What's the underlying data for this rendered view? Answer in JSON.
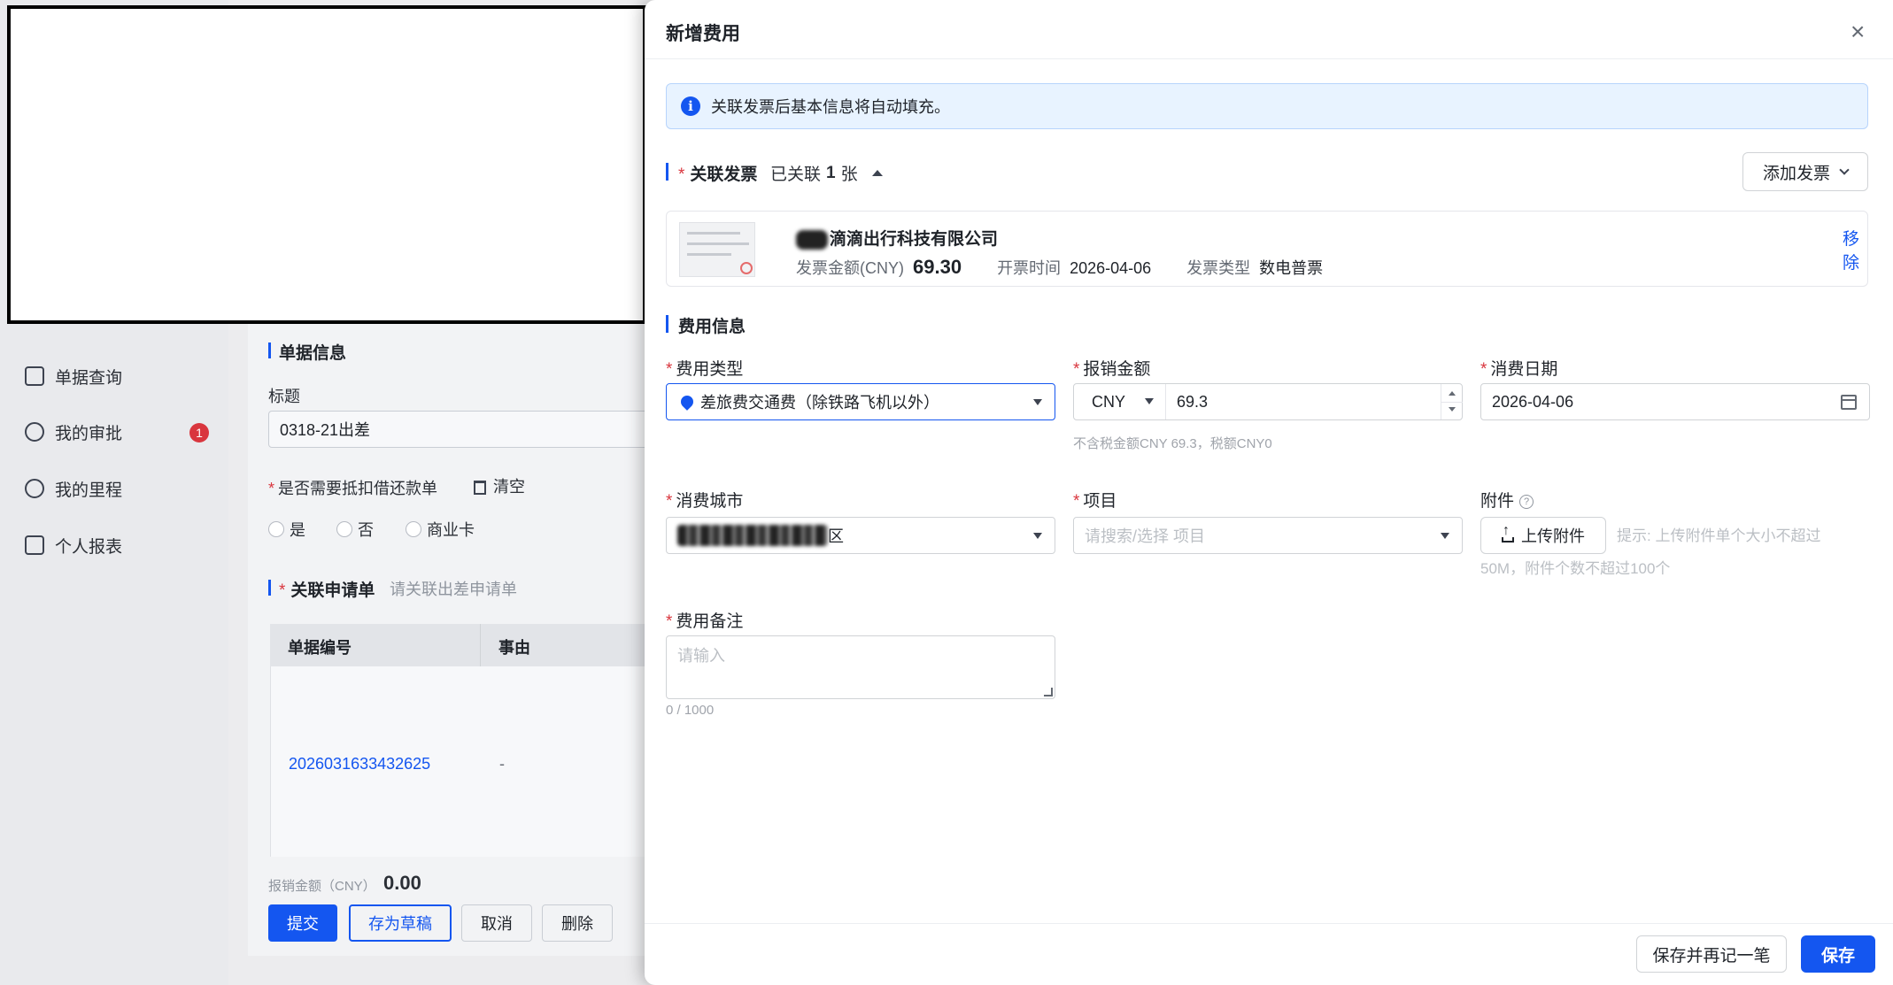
{
  "background": {
    "nav": [
      {
        "label": "单据查询",
        "icon": "search-doc-icon"
      },
      {
        "label": "我的审批",
        "icon": "user-icon",
        "badge": "1"
      },
      {
        "label": "我的里程",
        "icon": "odometer-icon"
      },
      {
        "label": "个人报表",
        "icon": "chart-icon"
      }
    ],
    "doc_info_title": "单据信息",
    "title_label": "标题",
    "title_value": "0318-21出差",
    "offset_question": "是否需要抵扣借还款单",
    "clear_label": "清空",
    "radio_options": [
      "是",
      "否",
      "商业卡"
    ],
    "linked_request_title": "关联申请单",
    "linked_request_hint": "请关联出差申请单",
    "table_headers": [
      "单据编号",
      "事由"
    ],
    "table_row": {
      "doc_no": "2026031633432625",
      "reason": "-"
    },
    "reimburse_label": "报销金额（CNY）",
    "reimburse_value": "0.00",
    "buttons": [
      "提交",
      "存为草稿",
      "取消",
      "删除"
    ]
  },
  "drawer": {
    "title": "新增费用",
    "close_symbol": "×",
    "info_text": "关联发票后基本信息将自动填充。",
    "invoice_section": {
      "title": "关联发票",
      "linked_prefix": "已关联",
      "linked_count": "1",
      "linked_suffix": "张",
      "add_button": "添加发票"
    },
    "invoice": {
      "company": "滴滴出行科技有限公司",
      "amount_label": "发票金额(CNY)",
      "amount": "69.30",
      "date_label": "开票时间",
      "date": "2026-04-06",
      "type_label": "发票类型",
      "type": "数电普票",
      "remove_label": "移除"
    },
    "expense_section_title": "费用信息",
    "fields": {
      "expense_type_label": "费用类型",
      "expense_type_value": "差旅费交通费（除铁路飞机以外）",
      "amount_label": "报销金额",
      "currency": "CNY",
      "amount_value": "69.3",
      "amount_hint": "不含税金额CNY 69.3，税额CNY0",
      "date_label": "消费日期",
      "date_value": "2026-04-06",
      "city_label": "消费城市",
      "city_suffix": "区",
      "project_label": "项目",
      "project_placeholder": "请搜索/选择 项目",
      "attachment_label": "附件",
      "upload_button": "上传附件",
      "upload_hint_line1": "提示: 上传附件单个大小不超过",
      "upload_hint_line2": "50M，附件个数不超过100个",
      "note_label": "费用备注",
      "note_placeholder": "请输入",
      "note_counter": "0 / 1000"
    },
    "footer": {
      "save_and_next": "保存并再记一笔",
      "save": "保存"
    }
  }
}
